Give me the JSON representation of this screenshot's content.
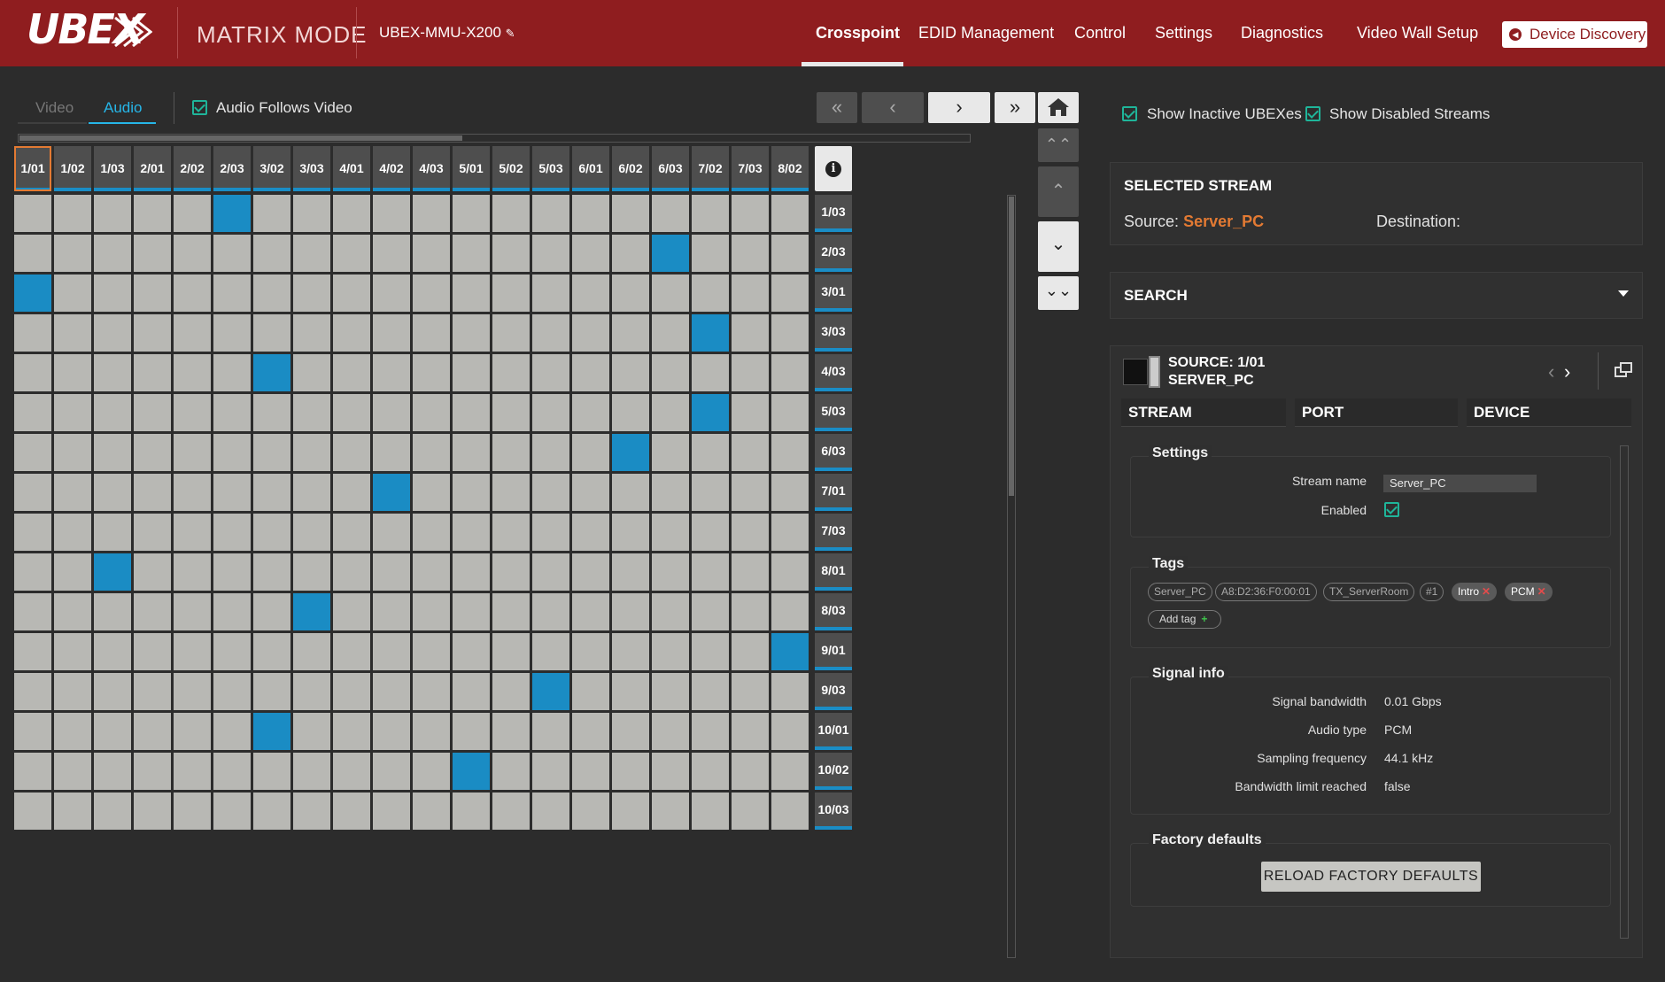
{
  "header": {
    "logo": "UBEX",
    "mode": "MATRIX MODE",
    "device_name": "UBEX-MMU-X200",
    "nav": [
      "Crosspoint",
      "EDID Management",
      "Control",
      "Settings",
      "Diagnostics",
      "Video Wall Setup"
    ],
    "active_nav": "Crosspoint",
    "device_discovery": "Device Discovery"
  },
  "toolbar": {
    "tab_video": "Video",
    "tab_audio": "Audio",
    "active_tab": "Audio",
    "audio_follows_video": "Audio Follows Video",
    "audio_follows_video_checked": true
  },
  "matrix": {
    "columns": [
      "1/01",
      "1/02",
      "1/03",
      "2/01",
      "2/02",
      "2/03",
      "3/02",
      "3/03",
      "4/01",
      "4/02",
      "4/03",
      "5/01",
      "5/02",
      "5/03",
      "6/01",
      "6/02",
      "6/03",
      "7/02",
      "7/03",
      "8/02"
    ],
    "rows": [
      "1/03",
      "2/03",
      "3/01",
      "3/03",
      "4/03",
      "5/03",
      "6/03",
      "7/01",
      "7/03",
      "8/01",
      "8/03",
      "9/01",
      "9/03",
      "10/01",
      "10/02",
      "10/03"
    ],
    "selected_column": "1/01",
    "connections": [
      {
        "row": "1/03",
        "col": "2/03"
      },
      {
        "row": "2/03",
        "col": "6/03"
      },
      {
        "row": "3/01",
        "col": "1/01"
      },
      {
        "row": "3/03",
        "col": "7/02"
      },
      {
        "row": "4/03",
        "col": "3/02"
      },
      {
        "row": "5/03",
        "col": "7/02"
      },
      {
        "row": "6/03",
        "col": "6/02"
      },
      {
        "row": "7/01",
        "col": "4/02"
      },
      {
        "row": "8/01",
        "col": "1/03"
      },
      {
        "row": "8/03",
        "col": "3/03"
      },
      {
        "row": "9/01",
        "col": "8/02"
      },
      {
        "row": "9/03",
        "col": "5/03"
      },
      {
        "row": "10/01",
        "col": "3/02"
      },
      {
        "row": "10/02",
        "col": "5/01"
      }
    ],
    "active_color": "#1a8cc4",
    "inactive_color": "#b8b8b4"
  },
  "panel": {
    "show_inactive": "Show Inactive UBEXes",
    "show_disabled": "Show Disabled Streams",
    "selected_stream_title": "SELECTED STREAM",
    "source_label": "Source:",
    "source_value": "Server_PC",
    "destination_label": "Destination:",
    "search_title": "SEARCH",
    "source_header_line1": "SOURCE: 1/01",
    "source_header_line2": "SERVER_PC",
    "tabs": [
      "STREAM",
      "PORT",
      "DEVICE"
    ],
    "settings": {
      "legend": "Settings",
      "stream_name_label": "Stream name",
      "stream_name_value": "Server_PC",
      "enabled_label": "Enabled",
      "enabled": true
    },
    "tags": {
      "legend": "Tags",
      "outlined": [
        "Server_PC",
        "A8:D2:36:F0:00:01",
        "TX_ServerRoom",
        "#1"
      ],
      "removable": [
        "Intro",
        "PCM"
      ],
      "add_tag": "Add tag"
    },
    "signal": {
      "legend": "Signal info",
      "rows": [
        {
          "label": "Signal bandwidth",
          "value": "0.01 Gbps"
        },
        {
          "label": "Audio type",
          "value": "PCM"
        },
        {
          "label": "Sampling frequency",
          "value": "44.1 kHz"
        },
        {
          "label": "Bandwidth limit reached",
          "value": "false"
        }
      ]
    },
    "factory": {
      "legend": "Factory defaults",
      "button": "RELOAD FACTORY DEFAULTS"
    }
  },
  "colors": {
    "header_bg": "#8f1d1f",
    "accent_blue": "#26b6e8",
    "accent_orange": "#e37a33",
    "check_green": "#1fb59a"
  }
}
